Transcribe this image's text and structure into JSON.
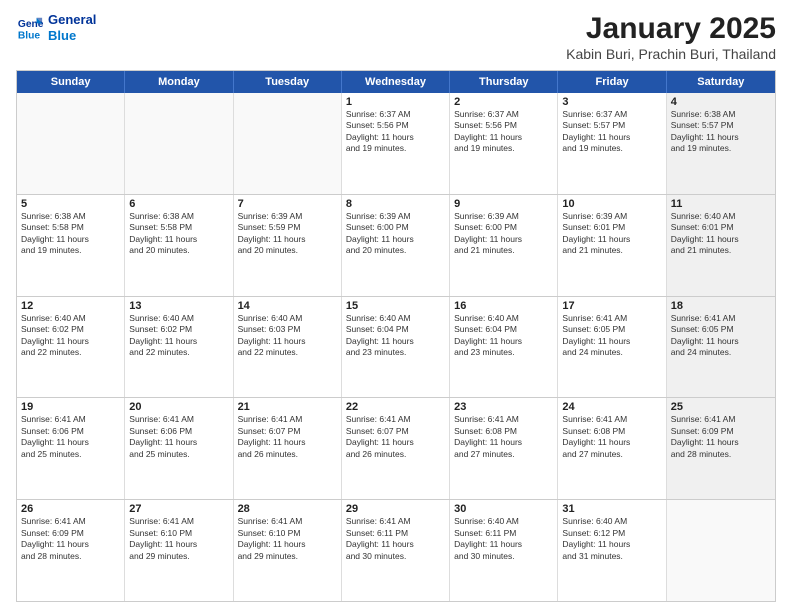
{
  "logo": {
    "line1": "General",
    "line2": "Blue"
  },
  "title": "January 2025",
  "subtitle": "Kabin Buri, Prachin Buri, Thailand",
  "headers": [
    "Sunday",
    "Monday",
    "Tuesday",
    "Wednesday",
    "Thursday",
    "Friday",
    "Saturday"
  ],
  "weeks": [
    [
      {
        "day": "",
        "detail": "",
        "empty": true
      },
      {
        "day": "",
        "detail": "",
        "empty": true
      },
      {
        "day": "",
        "detail": "",
        "empty": true
      },
      {
        "day": "1",
        "detail": "Sunrise: 6:37 AM\nSunset: 5:56 PM\nDaylight: 11 hours\nand 19 minutes."
      },
      {
        "day": "2",
        "detail": "Sunrise: 6:37 AM\nSunset: 5:56 PM\nDaylight: 11 hours\nand 19 minutes."
      },
      {
        "day": "3",
        "detail": "Sunrise: 6:37 AM\nSunset: 5:57 PM\nDaylight: 11 hours\nand 19 minutes."
      },
      {
        "day": "4",
        "detail": "Sunrise: 6:38 AM\nSunset: 5:57 PM\nDaylight: 11 hours\nand 19 minutes.",
        "shaded": true
      }
    ],
    [
      {
        "day": "5",
        "detail": "Sunrise: 6:38 AM\nSunset: 5:58 PM\nDaylight: 11 hours\nand 19 minutes."
      },
      {
        "day": "6",
        "detail": "Sunrise: 6:38 AM\nSunset: 5:58 PM\nDaylight: 11 hours\nand 20 minutes."
      },
      {
        "day": "7",
        "detail": "Sunrise: 6:39 AM\nSunset: 5:59 PM\nDaylight: 11 hours\nand 20 minutes."
      },
      {
        "day": "8",
        "detail": "Sunrise: 6:39 AM\nSunset: 6:00 PM\nDaylight: 11 hours\nand 20 minutes."
      },
      {
        "day": "9",
        "detail": "Sunrise: 6:39 AM\nSunset: 6:00 PM\nDaylight: 11 hours\nand 21 minutes."
      },
      {
        "day": "10",
        "detail": "Sunrise: 6:39 AM\nSunset: 6:01 PM\nDaylight: 11 hours\nand 21 minutes."
      },
      {
        "day": "11",
        "detail": "Sunrise: 6:40 AM\nSunset: 6:01 PM\nDaylight: 11 hours\nand 21 minutes.",
        "shaded": true
      }
    ],
    [
      {
        "day": "12",
        "detail": "Sunrise: 6:40 AM\nSunset: 6:02 PM\nDaylight: 11 hours\nand 22 minutes."
      },
      {
        "day": "13",
        "detail": "Sunrise: 6:40 AM\nSunset: 6:02 PM\nDaylight: 11 hours\nand 22 minutes."
      },
      {
        "day": "14",
        "detail": "Sunrise: 6:40 AM\nSunset: 6:03 PM\nDaylight: 11 hours\nand 22 minutes."
      },
      {
        "day": "15",
        "detail": "Sunrise: 6:40 AM\nSunset: 6:04 PM\nDaylight: 11 hours\nand 23 minutes."
      },
      {
        "day": "16",
        "detail": "Sunrise: 6:40 AM\nSunset: 6:04 PM\nDaylight: 11 hours\nand 23 minutes."
      },
      {
        "day": "17",
        "detail": "Sunrise: 6:41 AM\nSunset: 6:05 PM\nDaylight: 11 hours\nand 24 minutes."
      },
      {
        "day": "18",
        "detail": "Sunrise: 6:41 AM\nSunset: 6:05 PM\nDaylight: 11 hours\nand 24 minutes.",
        "shaded": true
      }
    ],
    [
      {
        "day": "19",
        "detail": "Sunrise: 6:41 AM\nSunset: 6:06 PM\nDaylight: 11 hours\nand 25 minutes."
      },
      {
        "day": "20",
        "detail": "Sunrise: 6:41 AM\nSunset: 6:06 PM\nDaylight: 11 hours\nand 25 minutes."
      },
      {
        "day": "21",
        "detail": "Sunrise: 6:41 AM\nSunset: 6:07 PM\nDaylight: 11 hours\nand 26 minutes."
      },
      {
        "day": "22",
        "detail": "Sunrise: 6:41 AM\nSunset: 6:07 PM\nDaylight: 11 hours\nand 26 minutes."
      },
      {
        "day": "23",
        "detail": "Sunrise: 6:41 AM\nSunset: 6:08 PM\nDaylight: 11 hours\nand 27 minutes."
      },
      {
        "day": "24",
        "detail": "Sunrise: 6:41 AM\nSunset: 6:08 PM\nDaylight: 11 hours\nand 27 minutes."
      },
      {
        "day": "25",
        "detail": "Sunrise: 6:41 AM\nSunset: 6:09 PM\nDaylight: 11 hours\nand 28 minutes.",
        "shaded": true
      }
    ],
    [
      {
        "day": "26",
        "detail": "Sunrise: 6:41 AM\nSunset: 6:09 PM\nDaylight: 11 hours\nand 28 minutes."
      },
      {
        "day": "27",
        "detail": "Sunrise: 6:41 AM\nSunset: 6:10 PM\nDaylight: 11 hours\nand 29 minutes."
      },
      {
        "day": "28",
        "detail": "Sunrise: 6:41 AM\nSunset: 6:10 PM\nDaylight: 11 hours\nand 29 minutes."
      },
      {
        "day": "29",
        "detail": "Sunrise: 6:41 AM\nSunset: 6:11 PM\nDaylight: 11 hours\nand 30 minutes."
      },
      {
        "day": "30",
        "detail": "Sunrise: 6:40 AM\nSunset: 6:11 PM\nDaylight: 11 hours\nand 30 minutes."
      },
      {
        "day": "31",
        "detail": "Sunrise: 6:40 AM\nSunset: 6:12 PM\nDaylight: 11 hours\nand 31 minutes."
      },
      {
        "day": "",
        "detail": "",
        "empty": true,
        "shaded": true
      }
    ]
  ]
}
